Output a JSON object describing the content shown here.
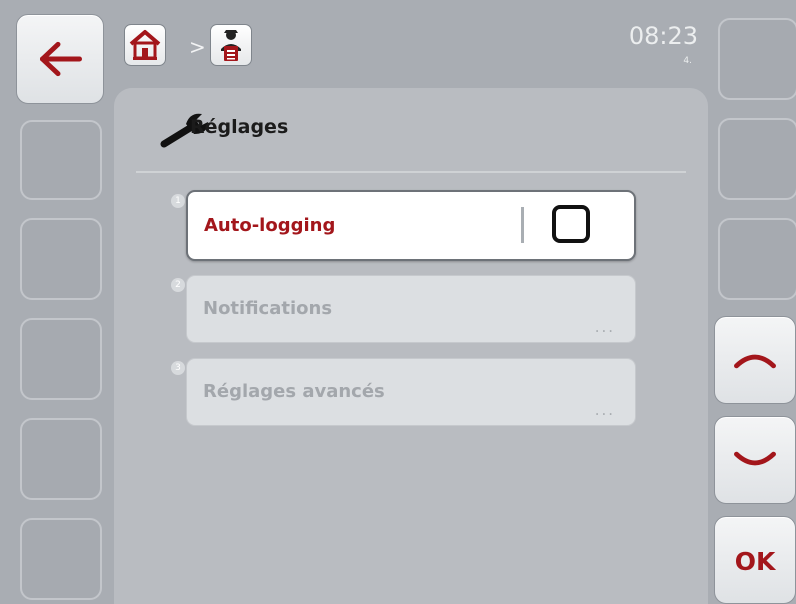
{
  "header": {
    "breadcrumb_separator": ">",
    "time": "08:23",
    "day_indicator": "4.",
    "breadcrumb_icons": [
      "home-icon",
      "operator-clipboard-icon"
    ]
  },
  "page": {
    "title": "Réglages",
    "title_icon": "wrench-icon"
  },
  "list": {
    "items": [
      {
        "number": "1",
        "label": "Auto-logging",
        "control": "checkbox",
        "checked": false,
        "selected": true
      },
      {
        "number": "2",
        "label": "Notifications",
        "more": "...",
        "selected": false
      },
      {
        "number": "3",
        "label": "Réglages avancés",
        "more": "...",
        "selected": false
      }
    ]
  },
  "softkeys": {
    "left": [
      "back-arrow-icon"
    ],
    "right": [
      "scroll-up-icon",
      "scroll-down-icon"
    ],
    "ok_label": "OK"
  },
  "colors": {
    "accent": "#a3161b",
    "background": "#a9adb3",
    "panel": "#b9bcc1"
  }
}
